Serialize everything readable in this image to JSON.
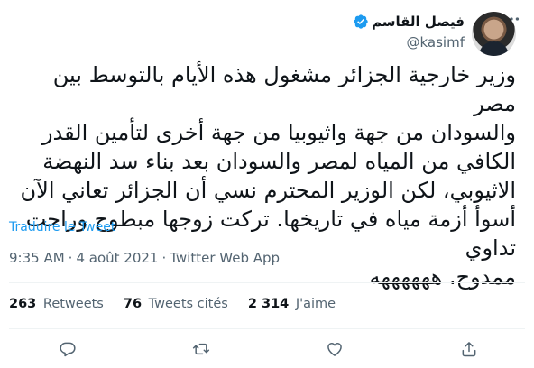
{
  "author": {
    "name": "فيصل القاسم",
    "handle": "@kasimf",
    "verified": true
  },
  "tweet": {
    "lines": [
      "وزير خارجية الجزائر مشغول هذه الأيام بالتوسط بين مصر",
      "والسودان من جهة واثيوبيا من جهة أخرى لتأمين القدر",
      "الكافي من المياه لمصر والسودان بعد بناء سد النهضة",
      "الاثيوبي، لكن الوزير المحترم نسي أن الجزائر تعاني الآن",
      "أسوأ أزمة مياه في تاريخها. تركت زوجها مبطوح وراحت تداوي",
      "ممدوح. ههههههه"
    ],
    "translate_label": "Traduire le Tweet",
    "time": "9:35 AM",
    "date": "4 août 2021",
    "source": "Twitter Web App",
    "separator": "·"
  },
  "stats": {
    "retweets_count": "263",
    "retweets_label": "Retweets",
    "quotes_count": "76",
    "quotes_label": "Tweets cités",
    "likes_count": "2 314",
    "likes_label": "J'aime"
  },
  "icons": {
    "more": "more-icon",
    "verified": "verified-badge-icon",
    "reply": "reply-icon",
    "retweet": "retweet-icon",
    "like": "heart-icon",
    "share": "share-icon"
  },
  "colors": {
    "accent": "#1d9bf0",
    "secondary_text": "#536471",
    "primary_text": "#0f1419"
  }
}
